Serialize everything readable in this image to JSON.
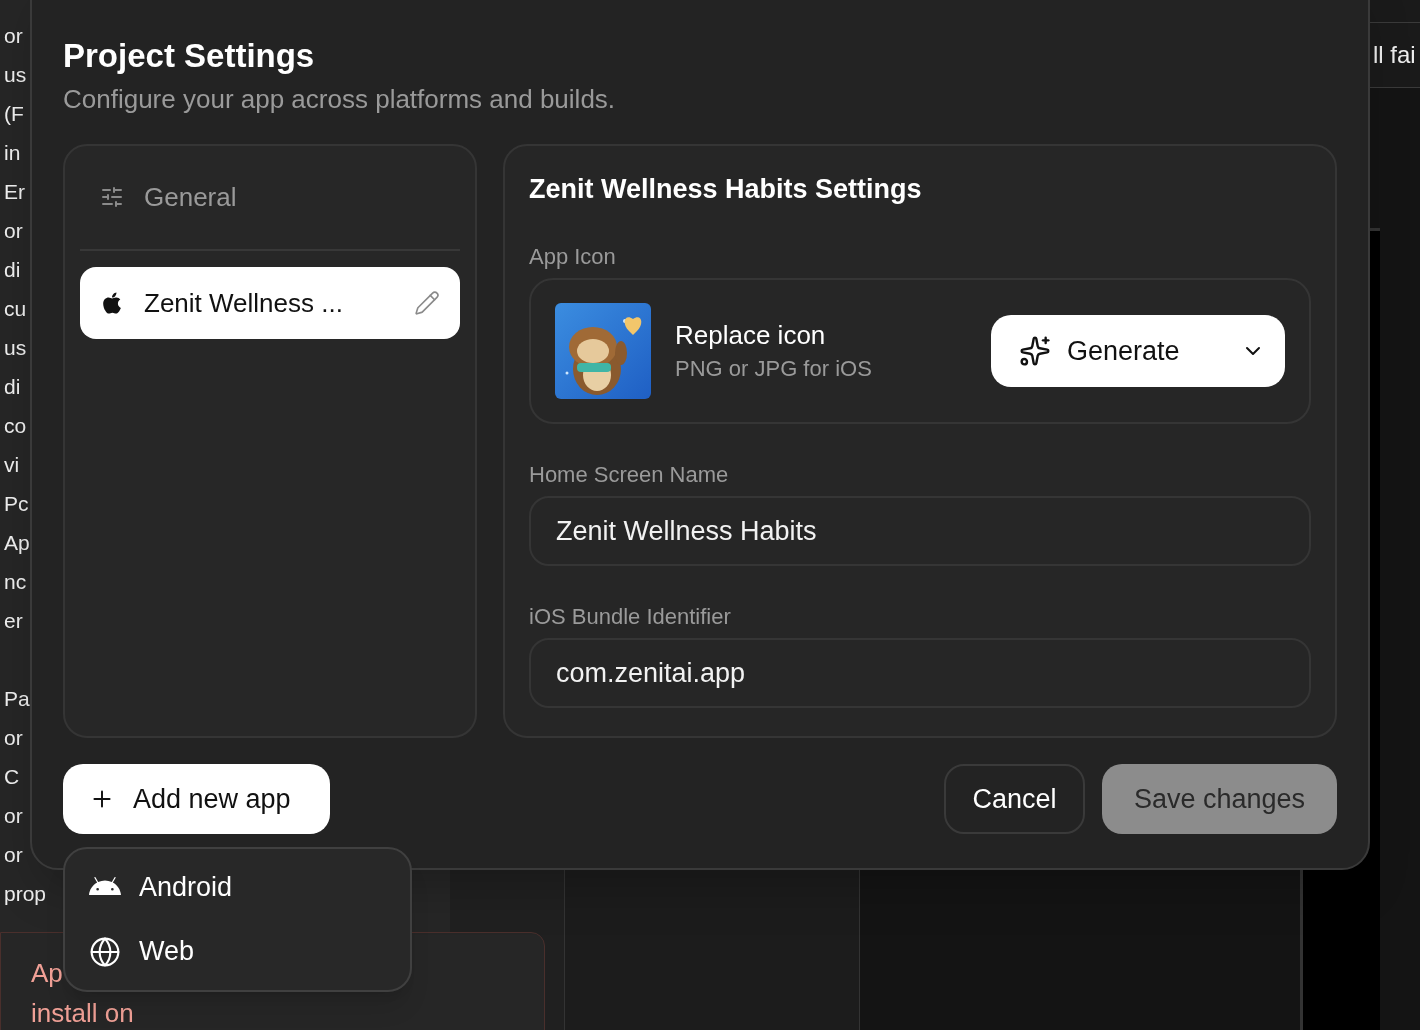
{
  "background": {
    "paragraphs": [
      [
        "or",
        "us",
        "(F",
        "in",
        "Er",
        "or",
        "di",
        "cu",
        "us",
        "di",
        "co",
        "vi",
        "Pc",
        "Ap",
        "nc",
        "er"
      ],
      [
        "Pa",
        "or",
        "C",
        "or",
        "or",
        "prop"
      ]
    ],
    "tab_text": "ll fai",
    "notice": {
      "lines": [
        "Ap",
        "install on"
      ]
    }
  },
  "dialog": {
    "title": "Project Settings",
    "subtitle": "Configure your app across platforms and builds.",
    "sidebar": {
      "items": [
        {
          "kind": "section",
          "label": "General",
          "selected": false
        },
        {
          "kind": "app",
          "label": "Zenit Wellness ...",
          "selected": true
        }
      ]
    },
    "panel": {
      "title": "Zenit Wellness Habits Settings",
      "app_icon": {
        "label": "App Icon",
        "title": "Replace icon",
        "hint": "PNG or JPG for iOS",
        "generate_button": "Generate"
      },
      "fields": [
        {
          "label": "Home Screen Name",
          "value": "Zenit Wellness Habits"
        },
        {
          "label": "iOS Bundle Identifier",
          "value": "com.zenitai.app"
        }
      ]
    },
    "add_button": "Add new app",
    "cancel_button": "Cancel",
    "save_button": {
      "label": "Save changes",
      "disabled": true
    }
  },
  "add_menu": {
    "items": [
      {
        "kind": "android",
        "label": "Android"
      },
      {
        "kind": "web",
        "label": "Web"
      }
    ]
  }
}
